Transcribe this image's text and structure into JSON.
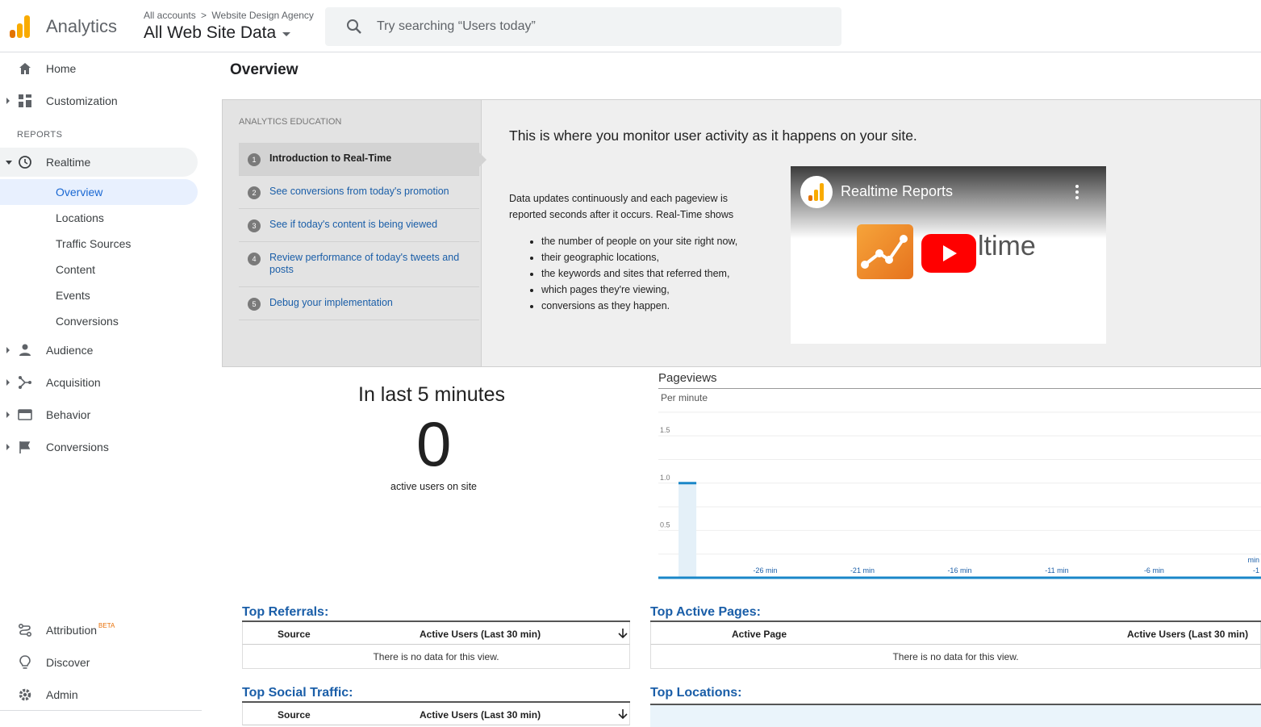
{
  "header": {
    "product": "Analytics",
    "breadcrumb_root": "All accounts",
    "breadcrumb_sep": ">",
    "breadcrumb_account": "Website Design Agency",
    "view": "All Web Site Data",
    "search_placeholder": "Try searching “Users today”"
  },
  "sidebar": {
    "home": "Home",
    "customization": "Customization",
    "reports_heading": "REPORTS",
    "realtime": "Realtime",
    "realtime_items": [
      "Overview",
      "Locations",
      "Traffic Sources",
      "Content",
      "Events",
      "Conversions"
    ],
    "audience": "Audience",
    "acquisition": "Acquisition",
    "behavior": "Behavior",
    "conversions": "Conversions",
    "attribution": "Attribution",
    "attribution_badge": "BETA",
    "discover": "Discover",
    "admin": "Admin"
  },
  "main": {
    "title": "Overview",
    "education": {
      "heading": "ANALYTICS EDUCATION",
      "steps": [
        {
          "num": "1",
          "text": "Introduction to Real-Time"
        },
        {
          "num": "2",
          "text": "See conversions from today's promotion"
        },
        {
          "num": "3",
          "text": "See if today's content is being viewed"
        },
        {
          "num": "4",
          "text": "Review performance of today's tweets and posts"
        },
        {
          "num": "5",
          "text": "Debug your implementation"
        }
      ],
      "headline": "This is where you monitor user activity as it happens on your site.",
      "body": "Data updates continuously and each pageview is reported seconds after it occurs. Real-Time shows",
      "bullets": [
        "the number of people on your site right now,",
        "their geographic locations,",
        "the keywords and sites that referred them,",
        "which pages they're viewing,",
        "conversions as they happen."
      ],
      "video_title": "Realtime Reports",
      "video_word": "ltime"
    },
    "active": {
      "heading": "In last 5 minutes",
      "count": "0",
      "label": "active users on site"
    },
    "pageviews": {
      "title": "Pageviews",
      "subtitle": "Per minute"
    },
    "top_referrals": {
      "title": "Top Referrals:",
      "col1": "Source",
      "col2": "Active Users (Last 30 min)",
      "empty": "There is no data for this view."
    },
    "top_active_pages": {
      "title": "Top Active Pages:",
      "col1": "Active Page",
      "col2": "Active Users (Last 30 min)",
      "empty": "There is no data for this view."
    },
    "top_social": {
      "title": "Top Social Traffic:",
      "col1": "Source",
      "col2": "Active Users (Last 30 min)"
    },
    "top_locations": {
      "title": "Top Locations:"
    }
  },
  "colors": {
    "accent": "#1a5ea8",
    "active_nav": "#1967d2",
    "chart_line": "#1a87c8",
    "logo_orange": "#f9ab00",
    "logo_dark_orange": "#e37400"
  },
  "chart_data": {
    "type": "bar",
    "ylabel": "",
    "ylim": [
      0,
      1.8
    ],
    "yticks": [
      0.5,
      1.0,
      1.5
    ],
    "x_tick_labels": [
      "-26 min",
      "-21 min",
      "-16 min",
      "-11 min",
      "-6 min",
      "min -1"
    ],
    "x_range": [
      -30,
      -1
    ],
    "series": [
      {
        "x": [
          -30
        ],
        "values": [
          1
        ]
      }
    ]
  }
}
